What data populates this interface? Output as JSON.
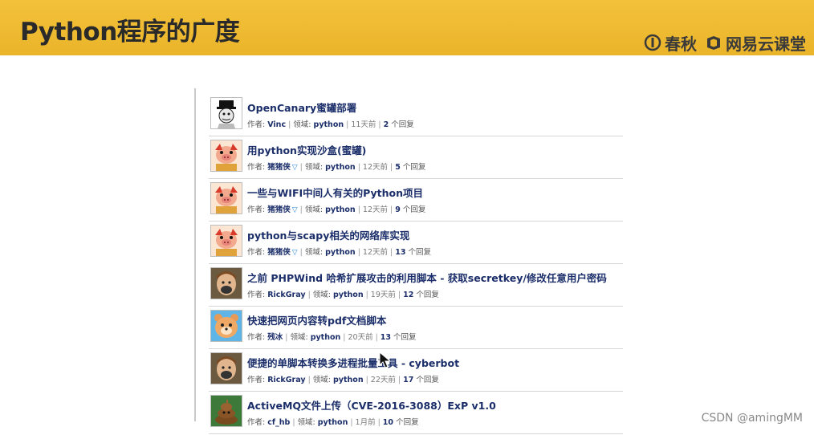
{
  "header": {
    "title": "Python程序的广度",
    "brand1": "春秋",
    "brand2": "网易云课堂",
    "brand1_icon": "chunqiu-logo-icon",
    "brand2_icon": "netease-classroom-logo-icon"
  },
  "labels": {
    "author": "作者:",
    "field": "领域:",
    "replies_suffix": "个回复"
  },
  "posts": [
    {
      "title": "OpenCanary蜜罐部署",
      "author": "Vinc",
      "field": "python",
      "time": "11天前",
      "replies": "2",
      "avatar": "meme-avatar"
    },
    {
      "title": "用python实现沙盒(蜜罐)",
      "author": "猪猪侠",
      "vip": "▽",
      "field": "python",
      "time": "12天前",
      "replies": "5",
      "avatar": "pig-avatar"
    },
    {
      "title": "一些与WIFI中间人有关的Python项目",
      "author": "猪猪侠",
      "vip": "▽",
      "field": "python",
      "time": "12天前",
      "replies": "9",
      "avatar": "pig-avatar"
    },
    {
      "title": "python与scapy相关的网络库实现",
      "author": "猪猪侠",
      "vip": "▽",
      "field": "python",
      "time": "12天前",
      "replies": "13",
      "avatar": "pig-avatar"
    },
    {
      "title": "之前 PHPWind 哈希扩展攻击的利用脚本 - 获取secretkey/修改任意用户密码",
      "author": "RickGray",
      "field": "python",
      "time": "19天前",
      "replies": "12",
      "avatar": "child-avatar"
    },
    {
      "title": "快速把网页内容转pdf文档脚本",
      "author": "残冰",
      "field": "python",
      "time": "20天前",
      "replies": "13",
      "avatar": "bear-avatar"
    },
    {
      "title": "便捷的单脚本转换多进程批量工具 - cyberbot",
      "author": "RickGray",
      "field": "python",
      "time": "22天前",
      "replies": "17",
      "avatar": "child-avatar"
    },
    {
      "title": "ActiveMQ文件上传（CVE-2016-3088）ExP v1.0",
      "author": "cf_hb",
      "field": "python",
      "time": "1月前",
      "replies": "10",
      "avatar": "poop-avatar"
    }
  ],
  "watermark": "CSDN @amingMM"
}
